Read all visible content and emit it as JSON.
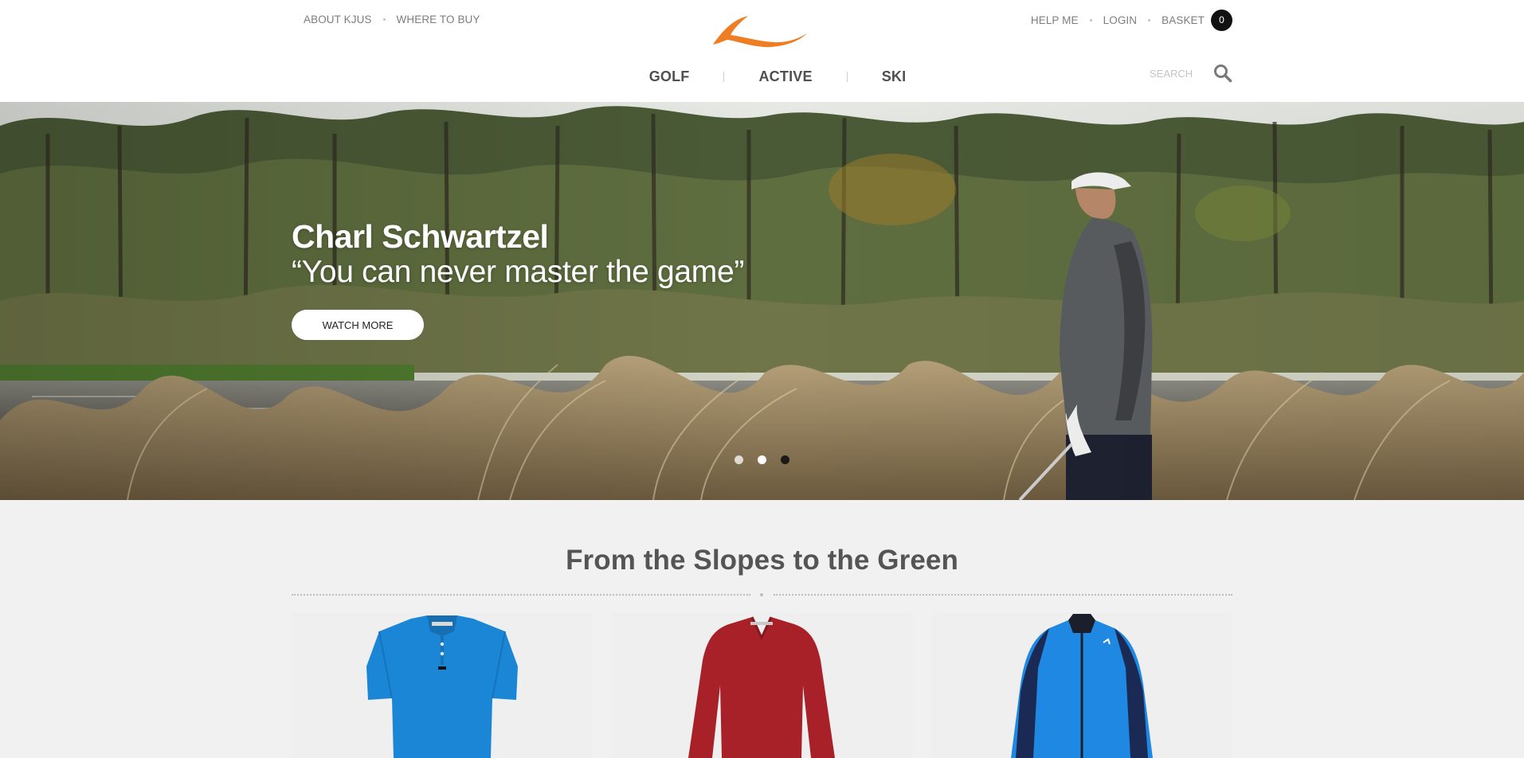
{
  "header": {
    "util_left": [
      {
        "label": "ABOUT KJUS"
      },
      {
        "label": "WHERE TO BUY"
      }
    ],
    "util_right": {
      "help": "HELP ME",
      "login": "LOGIN",
      "basket": "BASKET",
      "basket_count": "0"
    },
    "nav": [
      {
        "label": "GOLF"
      },
      {
        "label": "ACTIVE"
      },
      {
        "label": "SKI"
      }
    ],
    "search_placeholder": "SEARCH",
    "brand_color": "#ee7d24"
  },
  "hero": {
    "title": "Charl Schwartzel",
    "quote": "“You can never master the game”",
    "button": "WATCH MORE",
    "slides": 3,
    "active_slide": 3
  },
  "section": {
    "title": "From the Slopes to the Green"
  },
  "products": [
    {
      "name": "polo-shirt",
      "color": "#1b86d6"
    },
    {
      "name": "v-neck-sweater",
      "color": "#a82129"
    },
    {
      "name": "golf-jacket",
      "color": "#1e88e2"
    }
  ]
}
